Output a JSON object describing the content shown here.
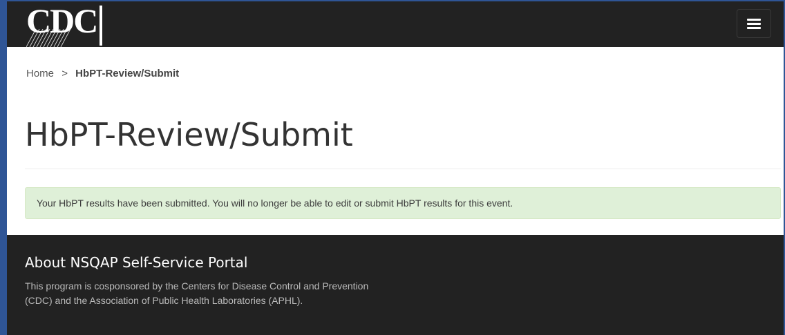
{
  "header": {
    "logo_text": "CDC",
    "menu_icon": "hamburger-menu-icon",
    "background_color": "#222222"
  },
  "breadcrumb": {
    "home": "Home",
    "separator": ">",
    "current": "HbPT-Review/Submit"
  },
  "page": {
    "title": "HbPT-Review/Submit"
  },
  "alert": {
    "type": "success",
    "message": "Your HbPT results have been submitted. You will no longer be able to edit or submit HbPT results for this event.",
    "background_color": "#dff0d8"
  },
  "footer": {
    "heading": "About NSQAP Self-Service Portal",
    "description": "This program is cosponsored by the Centers for Disease Control and Prevention (CDC) and the Association of Public Health Laboratories (APHL)."
  }
}
